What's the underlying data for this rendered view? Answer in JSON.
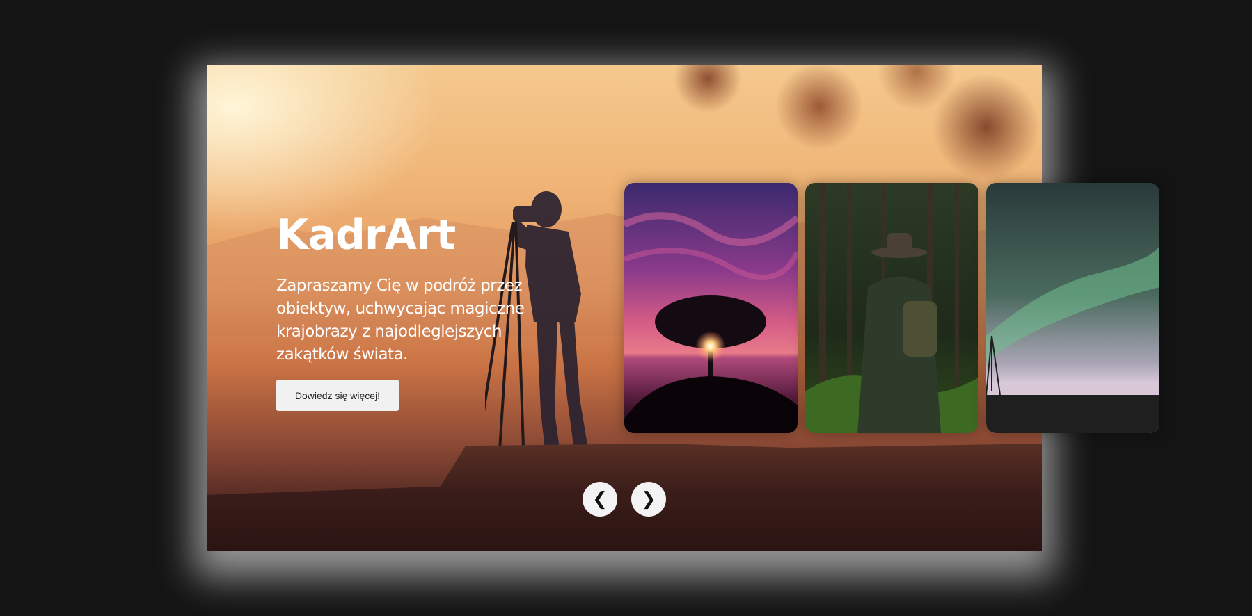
{
  "hero": {
    "title": "KadrArt",
    "subtitle": "Zapraszamy Cię w podróż przez obiektyw, uchwycając magiczne krajobrazy z najodleglejszych zakątków świata.",
    "cta_label": "Dowiedz się więcej!"
  },
  "carousel": {
    "prev_label": "❮",
    "next_label": "❯",
    "cards": [
      {
        "name": "tree-sunset-card"
      },
      {
        "name": "forest-traveler-card"
      },
      {
        "name": "aurora-card"
      }
    ]
  },
  "colors": {
    "page_bg": "#141414",
    "button_bg": "#f1f1f1",
    "text_light": "#ffffff"
  }
}
